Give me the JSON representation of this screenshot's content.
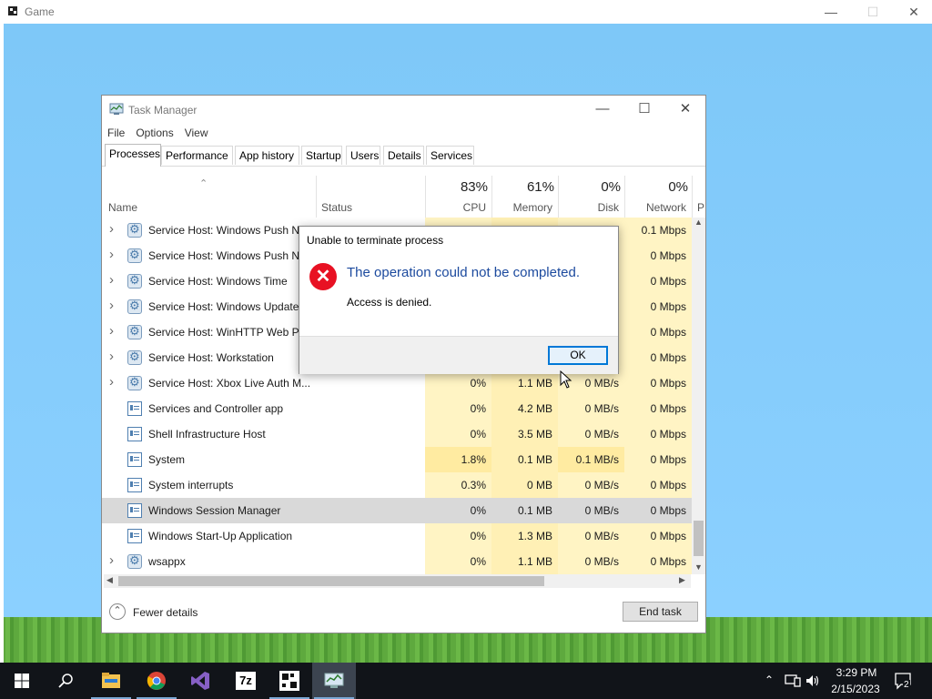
{
  "outer_window": {
    "title": "Game"
  },
  "task_manager": {
    "title": "Task Manager",
    "menu": [
      "File",
      "Options",
      "View"
    ],
    "tabs": [
      "Processes",
      "Performance",
      "App history",
      "Startup",
      "Users",
      "Details",
      "Services"
    ],
    "active_tab": "Processes",
    "columns": {
      "name": "Name",
      "status": "Status",
      "cpu": {
        "percent": "83%",
        "label": "CPU"
      },
      "memory": {
        "percent": "61%",
        "label": "Memory"
      },
      "disk": {
        "percent": "0%",
        "label": "Disk"
      },
      "network": {
        "percent": "0%",
        "label": "Network"
      },
      "power": "P"
    },
    "rows": [
      {
        "name": "Service Host: Windows Push No",
        "cpu": "",
        "mem": "",
        "disk": "",
        "net": "0.1 Mbps",
        "expandable": true,
        "icon": "gear"
      },
      {
        "name": "Service Host: Windows Push No",
        "cpu": "",
        "mem": "",
        "disk": "",
        "net": "0 Mbps",
        "expandable": true,
        "icon": "gear"
      },
      {
        "name": "Service Host: Windows Time",
        "cpu": "",
        "mem": "",
        "disk": "",
        "net": "0 Mbps",
        "expandable": true,
        "icon": "gear"
      },
      {
        "name": "Service Host: Windows Update",
        "cpu": "",
        "mem": "",
        "disk": "",
        "net": "0 Mbps",
        "expandable": true,
        "icon": "gear"
      },
      {
        "name": "Service Host: WinHTTP Web Pro",
        "cpu": "",
        "mem": "",
        "disk": "",
        "net": "0 Mbps",
        "expandable": true,
        "icon": "gear"
      },
      {
        "name": "Service Host: Workstation",
        "cpu": "",
        "mem": "",
        "disk": "",
        "net": "0 Mbps",
        "expandable": true,
        "icon": "gear"
      },
      {
        "name": "Service Host: Xbox Live Auth M...",
        "cpu": "0%",
        "mem": "1.1 MB",
        "disk": "0 MB/s",
        "net": "0 Mbps",
        "expandable": true,
        "icon": "gear"
      },
      {
        "name": "Services and Controller app",
        "cpu": "0%",
        "mem": "4.2 MB",
        "disk": "0 MB/s",
        "net": "0 Mbps",
        "expandable": false,
        "icon": "app"
      },
      {
        "name": "Shell Infrastructure Host",
        "cpu": "0%",
        "mem": "3.5 MB",
        "disk": "0 MB/s",
        "net": "0 Mbps",
        "expandable": false,
        "icon": "app"
      },
      {
        "name": "System",
        "cpu": "1.8%",
        "mem": "0.1 MB",
        "disk": "0.1 MB/s",
        "net": "0 Mbps",
        "expandable": false,
        "icon": "app"
      },
      {
        "name": "System interrupts",
        "cpu": "0.3%",
        "mem": "0 MB",
        "disk": "0 MB/s",
        "net": "0 Mbps",
        "expandable": false,
        "icon": "app"
      },
      {
        "name": "Windows Session Manager",
        "cpu": "0%",
        "mem": "0.1 MB",
        "disk": "0 MB/s",
        "net": "0 Mbps",
        "expandable": false,
        "icon": "app",
        "selected": true
      },
      {
        "name": "Windows Start-Up Application",
        "cpu": "0%",
        "mem": "1.3 MB",
        "disk": "0 MB/s",
        "net": "0 Mbps",
        "expandable": false,
        "icon": "app"
      },
      {
        "name": "wsappx",
        "cpu": "0%",
        "mem": "1.1 MB",
        "disk": "0 MB/s",
        "net": "0 Mbps",
        "expandable": true,
        "icon": "gear"
      }
    ],
    "footer": {
      "fewer_details": "Fewer details",
      "end_task": "End task"
    }
  },
  "dialog": {
    "title": "Unable to terminate process",
    "message": "The operation could not be completed.",
    "detail": "Access is denied.",
    "ok": "OK",
    "icon": "error-icon"
  },
  "taskbar": {
    "apps": [
      "start-icon",
      "search-icon",
      "file-explorer-icon",
      "chrome-icon",
      "visual-studio-icon",
      "7zip-icon",
      "game-app-icon",
      "task-manager-icon"
    ],
    "time": "3:29 PM",
    "date": "2/15/2023",
    "notification_count": "2"
  },
  "colors": {
    "sky": "#8bd0ff",
    "grass": "#5ea93e",
    "heat_light": "#fff4c4",
    "heat_mid": "#ffeba1",
    "selected_row": "#d9d9d9",
    "taskbar": "#111419",
    "accent": "#0078d7",
    "error": "#e81123"
  }
}
